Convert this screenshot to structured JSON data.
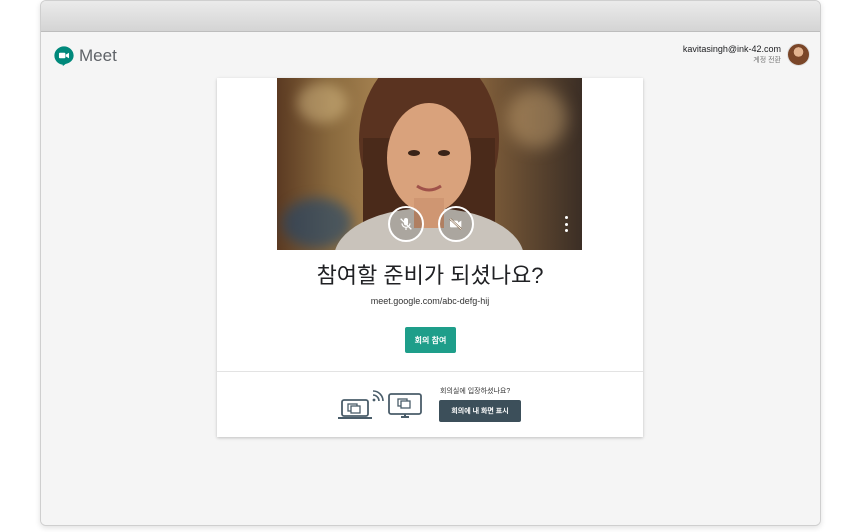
{
  "app": {
    "name": "Meet"
  },
  "account": {
    "email": "kavitasingh@ink-42.com",
    "switch_label": "계정 전환"
  },
  "main": {
    "heading": "참여할 준비가 되셨나요?",
    "meeting_url": "meet.google.com/abc-defg-hij",
    "join_label": "회의 참여"
  },
  "present": {
    "question": "회의실에 입장하셨나요?",
    "button_label": "회의에 내 화면 표시"
  },
  "colors": {
    "join": "#1e9e8a",
    "present": "#3c4f5a",
    "brand": "#00897b"
  },
  "icons": {
    "mic": "mic-off-icon",
    "camera": "camera-off-icon",
    "more": "more-vert-icon"
  }
}
